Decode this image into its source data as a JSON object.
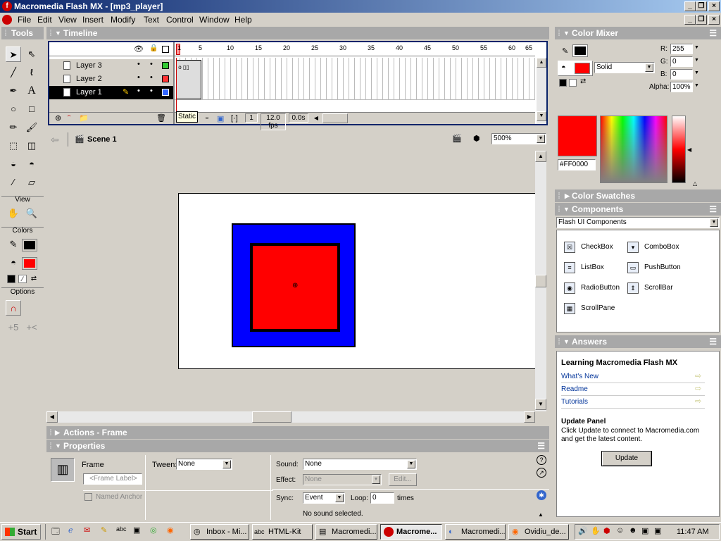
{
  "window": {
    "title": "Macromedia Flash MX - [mp3_player]"
  },
  "menu": [
    "File",
    "Edit",
    "View",
    "Insert",
    "Modify",
    "Text",
    "Control",
    "Window",
    "Help"
  ],
  "tools": {
    "header": "Tools",
    "view_label": "View",
    "colors_label": "Colors",
    "options_label": "Options",
    "stroke_color": "#000000",
    "fill_color": "#ff0000"
  },
  "timeline": {
    "header": "Timeline",
    "ruler": [
      "1",
      "5",
      "10",
      "15",
      "20",
      "25",
      "30",
      "35",
      "40",
      "45",
      "50",
      "55",
      "60",
      "65"
    ],
    "layers": [
      {
        "name": "Layer 3",
        "color": "#33cc33",
        "selected": false
      },
      {
        "name": "Layer 2",
        "color": "#ff3333",
        "selected": false
      },
      {
        "name": "Layer 1",
        "color": "#3366ff",
        "selected": true
      }
    ],
    "tooltip": "Static",
    "frame": "1",
    "fps": "12.0 fps",
    "time": "0.0s"
  },
  "stage": {
    "scene": "Scene 1",
    "zoom": "500%"
  },
  "panels": {
    "actions_header": "Actions - Frame",
    "properties_header": "Properties"
  },
  "properties": {
    "frame_label": "Frame",
    "frame_placeholder": "<Frame Label>",
    "tween_label": "Tween:",
    "tween_value": "None",
    "named_anchor": "Named Anchor",
    "sound_label": "Sound:",
    "sound_value": "None",
    "effect_label": "Effect:",
    "effect_value": "None",
    "edit_button": "Edit...",
    "sync_label": "Sync:",
    "sync_value": "Event",
    "loop_label": "Loop:",
    "loop_value": "0",
    "times_label": "times",
    "no_sound": "No sound selected."
  },
  "color_mixer": {
    "header": "Color Mixer",
    "fill_type": "Solid",
    "r_label": "R:",
    "r": "255",
    "g_label": "G:",
    "g": "0",
    "b_label": "B:",
    "b": "0",
    "alpha_label": "Alpha:",
    "alpha": "100%",
    "hex": "#FF0000",
    "current_color": "#ff0000"
  },
  "color_swatches": {
    "header": "Color Swatches"
  },
  "components": {
    "header": "Components",
    "set": "Flash UI Components",
    "items": [
      "CheckBox",
      "ComboBox",
      "ListBox",
      "PushButton",
      "RadioButton",
      "ScrollBar",
      "ScrollPane"
    ]
  },
  "answers": {
    "header": "Answers",
    "title": "Learning Macromedia Flash MX",
    "links": [
      "What's New",
      "Readme",
      "Tutorials"
    ],
    "update_title": "Update Panel",
    "update_text": "Click Update to connect to Macromedia.com and get the latest content.",
    "update_button": "Update"
  },
  "taskbar": {
    "start": "Start",
    "tasks": [
      "Inbox - Mi...",
      "HTML-Kit",
      "Macromedi...",
      "Macrome...",
      "Macromedi...",
      "Ovidiu_de..."
    ],
    "clock": "11:47 AM"
  }
}
